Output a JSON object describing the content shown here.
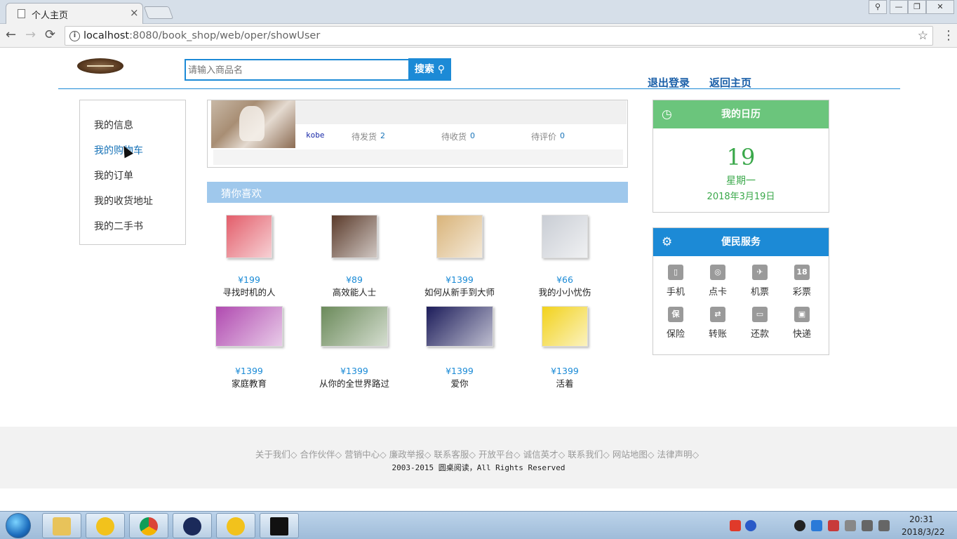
{
  "browser": {
    "tab_title": "个人主页",
    "tab_close": "×",
    "url_host": "localhost",
    "url_path": ":8080/book_shop/web/oper/showUser",
    "back": "←",
    "forward": "→",
    "reload": "⟳",
    "info": "i",
    "star": "☆",
    "menu": "⋮",
    "win_user": "⚲",
    "win_min": "—",
    "win_max": "❐",
    "win_close": "✕"
  },
  "header": {
    "search_placeholder": "请输入商品名",
    "search_button": "搜索",
    "logout": "退出登录",
    "home": "返回主页"
  },
  "left_menu": [
    {
      "label": "我的信息",
      "active": false
    },
    {
      "label": "我的购物车",
      "active": true
    },
    {
      "label": "我的订单",
      "active": false
    },
    {
      "label": "我的收货地址",
      "active": false
    },
    {
      "label": "我的二手书",
      "active": false
    }
  ],
  "user": {
    "name": "kobe",
    "stats": [
      {
        "label": "待发货",
        "value": "2"
      },
      {
        "label": "待收货",
        "value": "0"
      },
      {
        "label": "待评价",
        "value": "0"
      }
    ]
  },
  "guess": {
    "title": "猜你喜欢",
    "books": [
      {
        "price": "¥199",
        "title": "寻找时机的人",
        "color": "#e35d6a"
      },
      {
        "price": "¥89",
        "title": "高效能人士",
        "color": "#5a3a2a"
      },
      {
        "price": "¥1399",
        "title": "如何从新手到大师",
        "color": "#d9b47a"
      },
      {
        "price": "¥66",
        "title": "我的小小忧伤",
        "color": "#c9cdd4"
      },
      {
        "price": "¥1399",
        "title": "家庭教育",
        "color": "#b04ab0"
      },
      {
        "price": "¥1399",
        "title": "从你的全世界路过",
        "color": "#6b8a5a"
      },
      {
        "price": "¥1399",
        "title": "爱你",
        "color": "#1c1c5a"
      },
      {
        "price": "¥1399",
        "title": "活着",
        "color": "#f2d21c"
      }
    ]
  },
  "calendar": {
    "title": "我的日历",
    "day": "19",
    "weekday": "星期一",
    "date": "2018年3月19日",
    "header_color": "#6bc57c"
  },
  "services": {
    "title": "便民服务",
    "header_color": "#1c8ad6",
    "items": [
      {
        "label": "手机",
        "icon": "phone-icon",
        "glyph": "▯"
      },
      {
        "label": "点卡",
        "icon": "gamepad-icon",
        "glyph": "◎"
      },
      {
        "label": "机票",
        "icon": "plane-icon",
        "glyph": "✈"
      },
      {
        "label": "彩票",
        "icon": "lottery-icon",
        "glyph": "18"
      },
      {
        "label": "保险",
        "icon": "insurance-icon",
        "glyph": "保"
      },
      {
        "label": "转账",
        "icon": "transfer-icon",
        "glyph": "⇄"
      },
      {
        "label": "还款",
        "icon": "repay-icon",
        "glyph": "▭"
      },
      {
        "label": "快递",
        "icon": "truck-icon",
        "glyph": "▣"
      }
    ]
  },
  "footer": {
    "links": [
      "关于我们◇",
      "合作伙伴◇",
      "营销中心◇",
      "廉政举报◇",
      "联系客服◇",
      "开放平台◇",
      "诚信英才◇",
      "联系我们◇",
      "网站地图◇",
      "法律声明◇"
    ],
    "copyright": "2003-2015 圆桌阅读，All Rights Reserved"
  },
  "taskbar": {
    "time": "20:31",
    "date": "2018/3/22"
  }
}
